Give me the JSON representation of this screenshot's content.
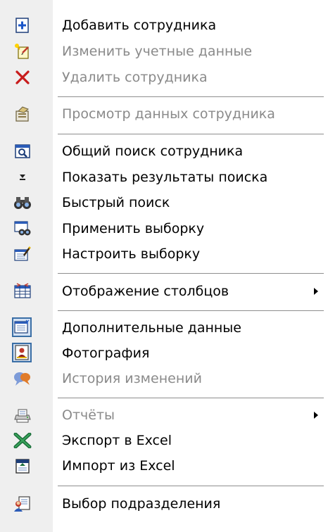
{
  "menu": {
    "items": [
      {
        "label": "Добавить сотрудника",
        "icon": "add-employee-icon",
        "enabled": true
      },
      {
        "label": "Изменить учетные данные",
        "icon": "edit-credentials-icon",
        "enabled": false
      },
      {
        "label": "Удалить сотрудника",
        "icon": "delete-icon",
        "enabled": false
      },
      {
        "label": "Просмотр данных сотрудника",
        "icon": "view-employee-icon",
        "enabled": false
      },
      {
        "label": "Общий поиск сотрудника",
        "icon": "general-search-icon",
        "enabled": true
      },
      {
        "label": "Показать результаты поиска",
        "icon": "show-results-icon",
        "enabled": true
      },
      {
        "label": "Быстрый поиск",
        "icon": "binoculars-icon",
        "enabled": true
      },
      {
        "label": "Применить выборку",
        "icon": "apply-filter-icon",
        "enabled": true
      },
      {
        "label": "Настроить выборку",
        "icon": "configure-filter-icon",
        "enabled": true
      },
      {
        "label": "Отображение столбцов",
        "icon": "columns-icon",
        "enabled": true,
        "submenu": true
      },
      {
        "label": "Дополнительные данные",
        "icon": "additional-data-icon",
        "enabled": true,
        "checked": true
      },
      {
        "label": "Фотография",
        "icon": "photo-icon",
        "enabled": true,
        "checked": true
      },
      {
        "label": "История изменений",
        "icon": "history-icon",
        "enabled": false
      },
      {
        "label": "Отчёты",
        "icon": "reports-icon",
        "enabled": false,
        "submenu": true
      },
      {
        "label": "Экспорт в Excel",
        "icon": "excel-export-icon",
        "enabled": true
      },
      {
        "label": "Импорт из Excel",
        "icon": "excel-import-icon",
        "enabled": true
      },
      {
        "label": "Выбор подразделения",
        "icon": "select-department-icon",
        "enabled": true
      }
    ]
  },
  "colors": {
    "enabled_text": "#000000",
    "disabled_text": "#8a8a8a",
    "checked_frame": "#3a6ea5"
  }
}
